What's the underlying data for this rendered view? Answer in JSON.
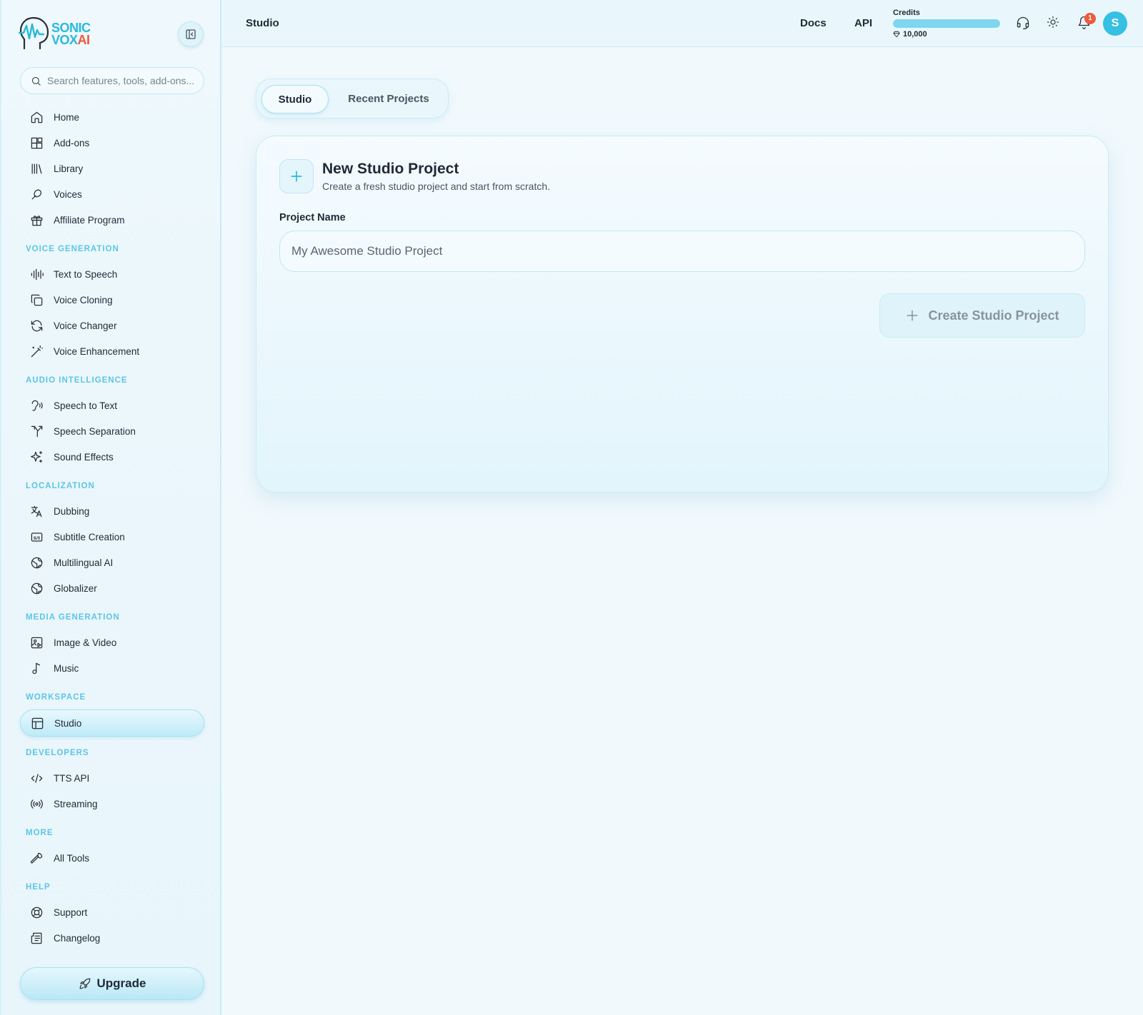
{
  "app": {
    "brand_line1": "SONIC",
    "brand_line2a": "VOX",
    "brand_line2b": "AI"
  },
  "search": {
    "placeholder": "Search features, tools, add-ons..."
  },
  "sidebar": {
    "top_items": [
      {
        "label": "Home",
        "icon": "home-icon"
      },
      {
        "label": "Add-ons",
        "icon": "addons-icon"
      },
      {
        "label": "Library",
        "icon": "library-icon"
      },
      {
        "label": "Voices",
        "icon": "voices-icon"
      },
      {
        "label": "Affiliate Program",
        "icon": "gift-icon"
      }
    ],
    "sections": [
      {
        "title": "VOICE GENERATION",
        "items": [
          {
            "label": "Text to Speech",
            "icon": "audio-lines-icon"
          },
          {
            "label": "Voice Cloning",
            "icon": "copy-icon"
          },
          {
            "label": "Voice Changer",
            "icon": "refresh-icon"
          },
          {
            "label": "Voice Enhancement",
            "icon": "wand-icon"
          }
        ]
      },
      {
        "title": "AUDIO INTELLIGENCE",
        "items": [
          {
            "label": "Speech to Text",
            "icon": "ear-icon"
          },
          {
            "label": "Speech Separation",
            "icon": "split-icon"
          },
          {
            "label": "Sound Effects",
            "icon": "sparkles-icon"
          }
        ]
      },
      {
        "title": "LOCALIZATION",
        "items": [
          {
            "label": "Dubbing",
            "icon": "translate-icon"
          },
          {
            "label": "Subtitle Creation",
            "icon": "captions-icon"
          },
          {
            "label": "Multilingual AI",
            "icon": "globe-icon"
          },
          {
            "label": "Globalizer",
            "icon": "globe-icon"
          }
        ]
      },
      {
        "title": "MEDIA GENERATION",
        "items": [
          {
            "label": "Image & Video",
            "icon": "image-video-icon"
          },
          {
            "label": "Music",
            "icon": "music-icon"
          }
        ]
      },
      {
        "title": "WORKSPACE",
        "items": [
          {
            "label": "Studio",
            "icon": "layout-icon"
          }
        ]
      },
      {
        "title": "DEVELOPERS",
        "items": [
          {
            "label": "TTS API",
            "icon": "code-icon"
          },
          {
            "label": "Streaming",
            "icon": "radio-icon"
          }
        ]
      },
      {
        "title": "MORE",
        "items": [
          {
            "label": "All Tools",
            "icon": "wrench-icon"
          }
        ]
      },
      {
        "title": "HELP",
        "items": [
          {
            "label": "Support",
            "icon": "lifebuoy-icon"
          },
          {
            "label": "Changelog",
            "icon": "newspaper-icon"
          }
        ]
      }
    ],
    "upgrade_label": "Upgrade"
  },
  "header": {
    "title": "Studio",
    "docs_label": "Docs",
    "api_label": "API",
    "credits_label": "Credits",
    "credits_value": "10,000",
    "credits_fill_fraction": 1.0,
    "notification_count": "1",
    "avatar_initial": "S"
  },
  "tabs": [
    {
      "label": "Studio",
      "active": true
    },
    {
      "label": "Recent Projects",
      "active": false
    }
  ],
  "card": {
    "title": "New Studio Project",
    "subtitle": "Create a fresh studio project and start from scratch.",
    "field_label": "Project Name",
    "field_placeholder": "My Awesome Studio Project",
    "field_value": "",
    "create_label": "Create Studio Project"
  },
  "colors": {
    "accent": "#29b8de",
    "brand_red": "#ef5a3c",
    "section_title": "#5cc6e6",
    "avatar_bg": "#36c0e3"
  }
}
